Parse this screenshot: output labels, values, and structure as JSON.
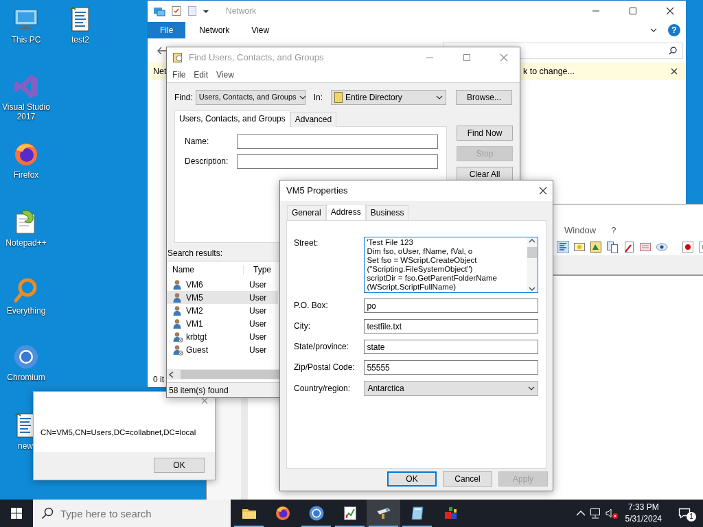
{
  "desktop_icons": [
    {
      "kind": "computer",
      "label": "This PC"
    },
    {
      "kind": "script",
      "label": "test2"
    },
    {
      "kind": "visual-studio",
      "label": "Visual Studio 2017"
    },
    {
      "kind": "firefox",
      "label": "Firefox"
    },
    {
      "kind": "notepad",
      "label": "Notepad++"
    },
    {
      "kind": "search",
      "label": "Everything"
    },
    {
      "kind": "chromium",
      "label": "Chromium"
    },
    {
      "kind": "script",
      "label": "new"
    }
  ],
  "explorer": {
    "title": "Network",
    "ribbon_tabs": [
      {
        "label": "File",
        "selected": true
      },
      {
        "label": "Network",
        "selected": false
      },
      {
        "label": "View",
        "selected": false
      }
    ],
    "help": "?",
    "info_bar_left": "Net",
    "info_bar_right": "k to change...",
    "status_bar": "0 it"
  },
  "notepad_window": {
    "menu": [
      "Window",
      "?"
    ]
  },
  "find_dialog": {
    "title": "Find Users, Contacts, and Groups",
    "menu": [
      "File",
      "Edit",
      "View"
    ],
    "find_label": "Find:",
    "find_value": "Users, Contacts, and Groups",
    "in_label": "In:",
    "in_value": "Entire Directory",
    "browse_button": "Browse...",
    "tabs": [
      {
        "label": "Users, Contacts, and Groups",
        "selected": true
      },
      {
        "label": "Advanced",
        "selected": false
      }
    ],
    "fields": [
      {
        "label": "Name:"
      },
      {
        "label": "Description:"
      }
    ],
    "buttons": [
      {
        "label": "Find Now",
        "disabled": false
      },
      {
        "label": "Stop",
        "disabled": true
      },
      {
        "label": "Clear All",
        "disabled": false
      }
    ],
    "results_label": "Search results:",
    "columns": [
      "Name",
      "Type"
    ],
    "rows": [
      {
        "kind": "user",
        "name": "VM6",
        "type": "User",
        "selected": false
      },
      {
        "kind": "user",
        "name": "VM5",
        "type": "User",
        "selected": true
      },
      {
        "kind": "user",
        "name": "VM2",
        "type": "User",
        "selected": false
      },
      {
        "kind": "user",
        "name": "VM1",
        "type": "User",
        "selected": false
      },
      {
        "kind": "disabled-user",
        "name": "krbtgt",
        "type": "User",
        "selected": false
      },
      {
        "kind": "disabled-user",
        "name": "Guest",
        "type": "User",
        "selected": false
      }
    ],
    "status_bar": "58 item(s) found"
  },
  "properties_dialog": {
    "title": "VM5 Properties",
    "tabs": [
      {
        "label": "General",
        "selected": false
      },
      {
        "label": "Address",
        "selected": true
      },
      {
        "label": "Business",
        "selected": false
      }
    ],
    "street_label": "Street:",
    "street_lines": [
      "'Test File 123",
      "Dim fso, oUser, fName, fVal, o",
      "Set fso = WScript.CreateObject",
      "(\"Scripting.FileSystemObject\")",
      "scriptDir = fso.GetParentFolderName",
      "(WScript.ScriptFullName)"
    ],
    "fields": [
      {
        "kind": "text",
        "label": "P.O. Box:",
        "value": "po"
      },
      {
        "kind": "text",
        "label": "City:",
        "value": "testfile.txt"
      },
      {
        "kind": "text",
        "label": "State/province:",
        "value": "state"
      },
      {
        "kind": "text",
        "label": "Zip/Postal Code:",
        "value": "55555"
      },
      {
        "kind": "dropdown",
        "label": "Country/region:",
        "value": "Antarctica"
      }
    ],
    "buttons": [
      {
        "label": "OK",
        "default": true,
        "disabled": false
      },
      {
        "label": "Cancel",
        "default": false,
        "disabled": false
      },
      {
        "label": "Apply",
        "default": false,
        "disabled": true
      }
    ]
  },
  "message_box": {
    "text": "CN=VM5,CN=Users,DC=collabnet,DC=local",
    "button": "OK"
  },
  "taskbar": {
    "search_placeholder": "Type here to search",
    "apps": [
      {
        "kind": "folder",
        "running": true,
        "selected": false
      },
      {
        "kind": "firefox",
        "running": false,
        "selected": false
      },
      {
        "kind": "chromium",
        "running": true,
        "selected": false
      },
      {
        "kind": "chart",
        "running": true,
        "selected": false
      },
      {
        "kind": "tool",
        "running": true,
        "selected": true
      },
      {
        "kind": "glass",
        "running": true,
        "selected": false
      },
      {
        "kind": "shapes",
        "running": false,
        "selected": false
      }
    ],
    "time": "7:33 PM",
    "date": "5/31/2024",
    "notifications": "1"
  }
}
